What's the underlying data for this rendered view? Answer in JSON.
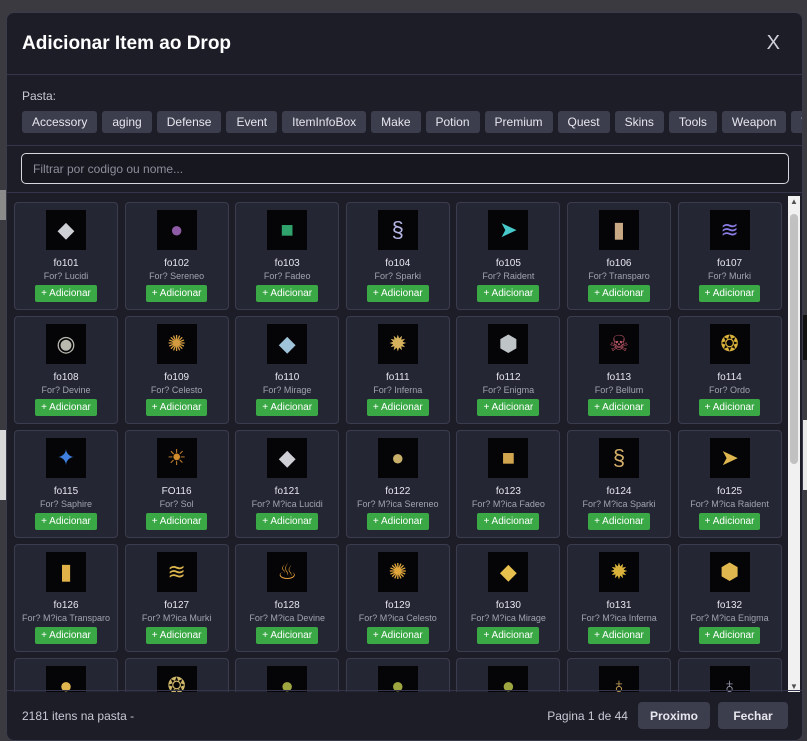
{
  "modal": {
    "title": "Adicionar Item ao Drop",
    "close_label": "X"
  },
  "folders": {
    "label": "Pasta:",
    "items": [
      "Accessory",
      "aging",
      "Defense",
      "Event",
      "ItemInfoBox",
      "Make",
      "Potion",
      "Premium",
      "Quest",
      "Skins",
      "Tools",
      "Weapon",
      "Wing"
    ]
  },
  "search": {
    "placeholder": "Filtrar por codigo ou nome..."
  },
  "add_label": "+ Adicionar",
  "items": [
    {
      "code": "fo101",
      "name": "For? Lucidi",
      "icon": "gem-icon",
      "glyph": "◆",
      "color": "#cfcfd6"
    },
    {
      "code": "fo102",
      "name": "For? Sereneo",
      "icon": "orb-icon",
      "glyph": "●",
      "color": "#8e5ba6"
    },
    {
      "code": "fo103",
      "name": "For? Fadeo",
      "icon": "crystal-icon",
      "glyph": "■",
      "color": "#2fa36b"
    },
    {
      "code": "fo104",
      "name": "For? Sparki",
      "icon": "swirl-icon",
      "glyph": "§",
      "color": "#b6b7e6"
    },
    {
      "code": "fo105",
      "name": "For? Raident",
      "icon": "arrow-icon",
      "glyph": "➤",
      "color": "#47c9c9"
    },
    {
      "code": "fo106",
      "name": "For? Transparo",
      "icon": "scroll-icon",
      "glyph": "▮",
      "color": "#c9a983"
    },
    {
      "code": "fo107",
      "name": "For? Murki",
      "icon": "claw-icon",
      "glyph": "≋",
      "color": "#8a7ee6"
    },
    {
      "code": "fo108",
      "name": "For? Devine",
      "icon": "stone-icon",
      "glyph": "◉",
      "color": "#b9b9b0"
    },
    {
      "code": "fo109",
      "name": "For? Celesto",
      "icon": "swirl-icon",
      "glyph": "✺",
      "color": "#d39b3f"
    },
    {
      "code": "fo110",
      "name": "For? Mirage",
      "icon": "shard-icon",
      "glyph": "◆",
      "color": "#9fc3d8"
    },
    {
      "code": "fo111",
      "name": "For? Inferna",
      "icon": "amulet-icon",
      "glyph": "✹",
      "color": "#d6b25c"
    },
    {
      "code": "fo112",
      "name": "For? Enigma",
      "icon": "stone-icon",
      "glyph": "⬢",
      "color": "#bfc4c6"
    },
    {
      "code": "fo113",
      "name": "For? Bellum",
      "icon": "skull-icon",
      "glyph": "☠",
      "color": "#c1586a"
    },
    {
      "code": "fo114",
      "name": "For? Ordo",
      "icon": "amulet-icon",
      "glyph": "❂",
      "color": "#d9b13b"
    },
    {
      "code": "fo115",
      "name": "For? Saphire",
      "icon": "sapphire-icon",
      "glyph": "✦",
      "color": "#3e7fe0"
    },
    {
      "code": "FO116",
      "name": "For? Sol",
      "icon": "sun-icon",
      "glyph": "☀",
      "color": "#d18a2c"
    },
    {
      "code": "fo121",
      "name": "For? M?ica Lucidi",
      "icon": "gem-icon",
      "glyph": "◆",
      "color": "#cfcfd6"
    },
    {
      "code": "fo122",
      "name": "For? M?ica Sereneo",
      "icon": "orb-icon",
      "glyph": "●",
      "color": "#c9b06a"
    },
    {
      "code": "fo123",
      "name": "For? M?ica Fadeo",
      "icon": "crystal-icon",
      "glyph": "■",
      "color": "#d2a64f"
    },
    {
      "code": "fo124",
      "name": "For? M?ica Sparki",
      "icon": "swirl-icon",
      "glyph": "§",
      "color": "#d6b069"
    },
    {
      "code": "fo125",
      "name": "For? M?ica Raident",
      "icon": "arrow-icon",
      "glyph": "➤",
      "color": "#e0b74f"
    },
    {
      "code": "fo126",
      "name": "For? M?ica Transparo",
      "icon": "scroll-icon",
      "glyph": "▮",
      "color": "#e0b148"
    },
    {
      "code": "fo127",
      "name": "For? M?ica Murki",
      "icon": "claw-icon",
      "glyph": "≋",
      "color": "#e0b74f"
    },
    {
      "code": "fo128",
      "name": "For? M?ica Devine",
      "icon": "flame-icon",
      "glyph": "♨",
      "color": "#e8a13c"
    },
    {
      "code": "fo129",
      "name": "For? M?ica Celesto",
      "icon": "swirl-icon",
      "glyph": "✺",
      "color": "#e0a63c"
    },
    {
      "code": "fo130",
      "name": "For? M?ica Mirage",
      "icon": "shard-icon",
      "glyph": "◆",
      "color": "#e8c04d"
    },
    {
      "code": "fo131",
      "name": "For? M?ica Inferna",
      "icon": "amulet-icon",
      "glyph": "✹",
      "color": "#d9b13b"
    },
    {
      "code": "fo132",
      "name": "For? M?ica Enigma",
      "icon": "stone-icon",
      "glyph": "⬢",
      "color": "#e0b74f"
    },
    {
      "code": "",
      "name": "",
      "icon": "orb-icon",
      "glyph": "●",
      "color": "#e0b74f"
    },
    {
      "code": "",
      "name": "",
      "icon": "amulet-icon",
      "glyph": "❂",
      "color": "#d0b86a"
    },
    {
      "code": "",
      "name": "",
      "icon": "orb-icon",
      "glyph": "●",
      "color": "#9ea640"
    },
    {
      "code": "",
      "name": "",
      "icon": "orb-icon",
      "glyph": "●",
      "color": "#9ea640"
    },
    {
      "code": "",
      "name": "",
      "icon": "orb-icon",
      "glyph": "●",
      "color": "#9ea640"
    },
    {
      "code": "",
      "name": "",
      "icon": "necklace-icon",
      "glyph": "♁",
      "color": "#c9a35a"
    },
    {
      "code": "",
      "name": "",
      "icon": "necklace-icon",
      "glyph": "♁",
      "color": "#9a9ab0"
    }
  ],
  "footer": {
    "count_text": "2181 itens na pasta -",
    "page_text": "Pagina 1 de 44",
    "next_label": "Proximo",
    "close_label": "Fechar"
  },
  "scrollbar": {
    "position": 0
  }
}
